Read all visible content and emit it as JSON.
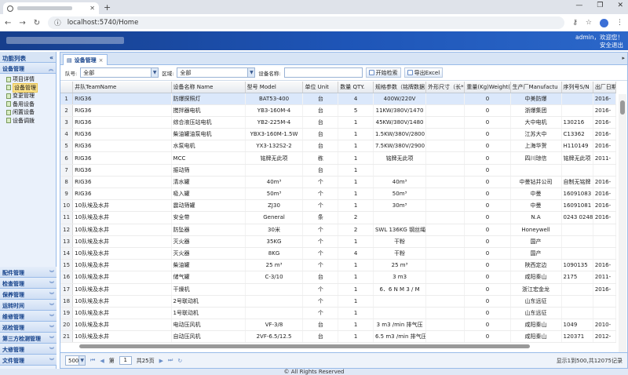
{
  "browser": {
    "url": "localhost:5740/Home"
  },
  "header": {
    "user": "admin，欢迎您！",
    "logout": "安全退出"
  },
  "sidebar": {
    "title": "功能列表",
    "active_group": "设备管理",
    "items": [
      {
        "label": "项目详情"
      },
      {
        "label": "设备管理",
        "selected": true
      },
      {
        "label": "变更管理"
      },
      {
        "label": "备用设备"
      },
      {
        "label": "闲置设备"
      },
      {
        "label": "设备调拨"
      }
    ],
    "groups": [
      {
        "label": "配件管理"
      },
      {
        "label": "检查管理"
      },
      {
        "label": "保养管理"
      },
      {
        "label": "运转时间"
      },
      {
        "label": "维修管理"
      },
      {
        "label": "巡检管理"
      },
      {
        "label": "第三方检测管理"
      },
      {
        "label": "大修管理"
      },
      {
        "label": "文件管理"
      }
    ]
  },
  "main": {
    "tab": "设备管理"
  },
  "toolbar": {
    "team_label": "队号:",
    "team_value": "全部",
    "area_label": "区域:",
    "area_value": "全部",
    "name_label": "设备名称:",
    "search_button": "开始检索",
    "export_button": "导出Excel"
  },
  "table": {
    "columns": [
      "井队TeamName",
      "设备名称 Name",
      "型号 Model",
      "单位 Unit",
      "数量 QTY.",
      "规格参数（铭牌数据",
      "外形尺寸（长*宽*",
      "重量(Kg)Weight(K",
      "生产厂Manufactu",
      "序列号S/N",
      "出厂日期Da"
    ],
    "rows": [
      [
        "RIG36",
        "防爆探照灯",
        "BAT53-400",
        "台",
        "4",
        "400W/220V",
        "",
        "0",
        "中美防爆",
        "",
        "2016-"
      ],
      [
        "RIG36",
        "搅拌器电机",
        "YB3-160M-4",
        "台",
        "5",
        "11KW/380V/1470",
        "",
        "0",
        "浙爆集团",
        "",
        "2016-"
      ],
      [
        "RIG36",
        "综合液压站电机",
        "YB2-225M-4",
        "台",
        "1",
        "45KW/380V/1480",
        "",
        "0",
        "大中电机",
        "130216",
        "2016-"
      ],
      [
        "RIG36",
        "柴油罐油泵电机",
        "YBX3-160M-1.5W",
        "台",
        "1",
        "1.5KW/380V/2800",
        "",
        "0",
        "江苏大中",
        "C13362",
        "2016-"
      ],
      [
        "RIG36",
        "水泵电机",
        "YX3-132S2-2",
        "台",
        "1",
        "7.5KW/380V/2900",
        "",
        "0",
        "上海华贺",
        "H110149",
        "2016-"
      ],
      [
        "RIG36",
        "MCC",
        "铭牌无此项",
        "栋",
        "1",
        "铭牌无此项",
        "",
        "0",
        "四川琼信",
        "铭牌无此项",
        "2011-"
      ],
      [
        "RIG36",
        "振动筛",
        "",
        "台",
        "1",
        "",
        "",
        "0",
        "",
        "",
        ""
      ],
      [
        "RIG36",
        "清水罐",
        "40m³",
        "个",
        "1",
        "40m³",
        "",
        "0",
        "中曼钻井公司",
        "自制无铭牌",
        "2016-"
      ],
      [
        "RIG36",
        "吸入罐",
        "50m³",
        "个",
        "1",
        "50m³",
        "",
        "0",
        "中曼",
        "16091083",
        "2016-"
      ],
      [
        "10队埃及水井",
        "震动筛罐",
        "ZJ30",
        "个",
        "1",
        "30m³",
        "",
        "0",
        "中曼",
        "16091081",
        "2016-"
      ],
      [
        "10队埃及水井",
        "安全带",
        "General",
        "条",
        "2",
        "",
        "",
        "0",
        "N.A",
        "0243 0248",
        "2016-"
      ],
      [
        "10队埃及水井",
        "防坠器",
        "30米",
        "个",
        "2",
        "SWL 136KG 钢丝绳",
        "",
        "0",
        "Honeywell",
        "",
        ""
      ],
      [
        "10队埃及水井",
        "灭火器",
        "35KG",
        "个",
        "1",
        "干粉",
        "",
        "0",
        "国产",
        "",
        ""
      ],
      [
        "10队埃及水井",
        "灭火器",
        "8KG",
        "个",
        "4",
        "干粉",
        "",
        "0",
        "国产",
        "",
        ""
      ],
      [
        "10队埃及水井",
        "柴油罐",
        "25 m³",
        "个",
        "1",
        "25 m³",
        "",
        "0",
        "陕西定边",
        "1090135",
        "2016-"
      ],
      [
        "10队埃及水井",
        "储气罐",
        "C-3/10",
        "台",
        "1",
        "3 m3",
        "",
        "0",
        "咸阳秦山",
        "2175",
        "2011-"
      ],
      [
        "10队埃及水井",
        "干燥机",
        "",
        "个",
        "1",
        "6．6 N M 3 / M",
        "",
        "0",
        "浙江宏金龙",
        "",
        "2016-"
      ],
      [
        "10队埃及水井",
        "2号联动机",
        "",
        "个",
        "1",
        "",
        "",
        "0",
        "山东远征",
        "",
        ""
      ],
      [
        "10队埃及水井",
        "1号联动机",
        "",
        "个",
        "1",
        "",
        "",
        "0",
        "山东远征",
        "",
        ""
      ],
      [
        "10队埃及水井",
        "电动压风机",
        "VF-3/8",
        "台",
        "1",
        "3 m3 /min 排气压",
        "",
        "0",
        "咸阳秦山",
        "1049",
        "2010-"
      ],
      [
        "10队埃及水井",
        "自动压风机",
        "2VF-6.5/12.5",
        "台",
        "1",
        "6.5 m3 /min 排气压",
        "",
        "0",
        "咸阳秦山",
        "120371",
        "2012-"
      ]
    ]
  },
  "pager": {
    "page_size": "500",
    "page_prefix": "第",
    "page": "1",
    "page_total": "共25页",
    "info": "显示1到500,共12075记录"
  },
  "footer": "© All Rights Reserved"
}
